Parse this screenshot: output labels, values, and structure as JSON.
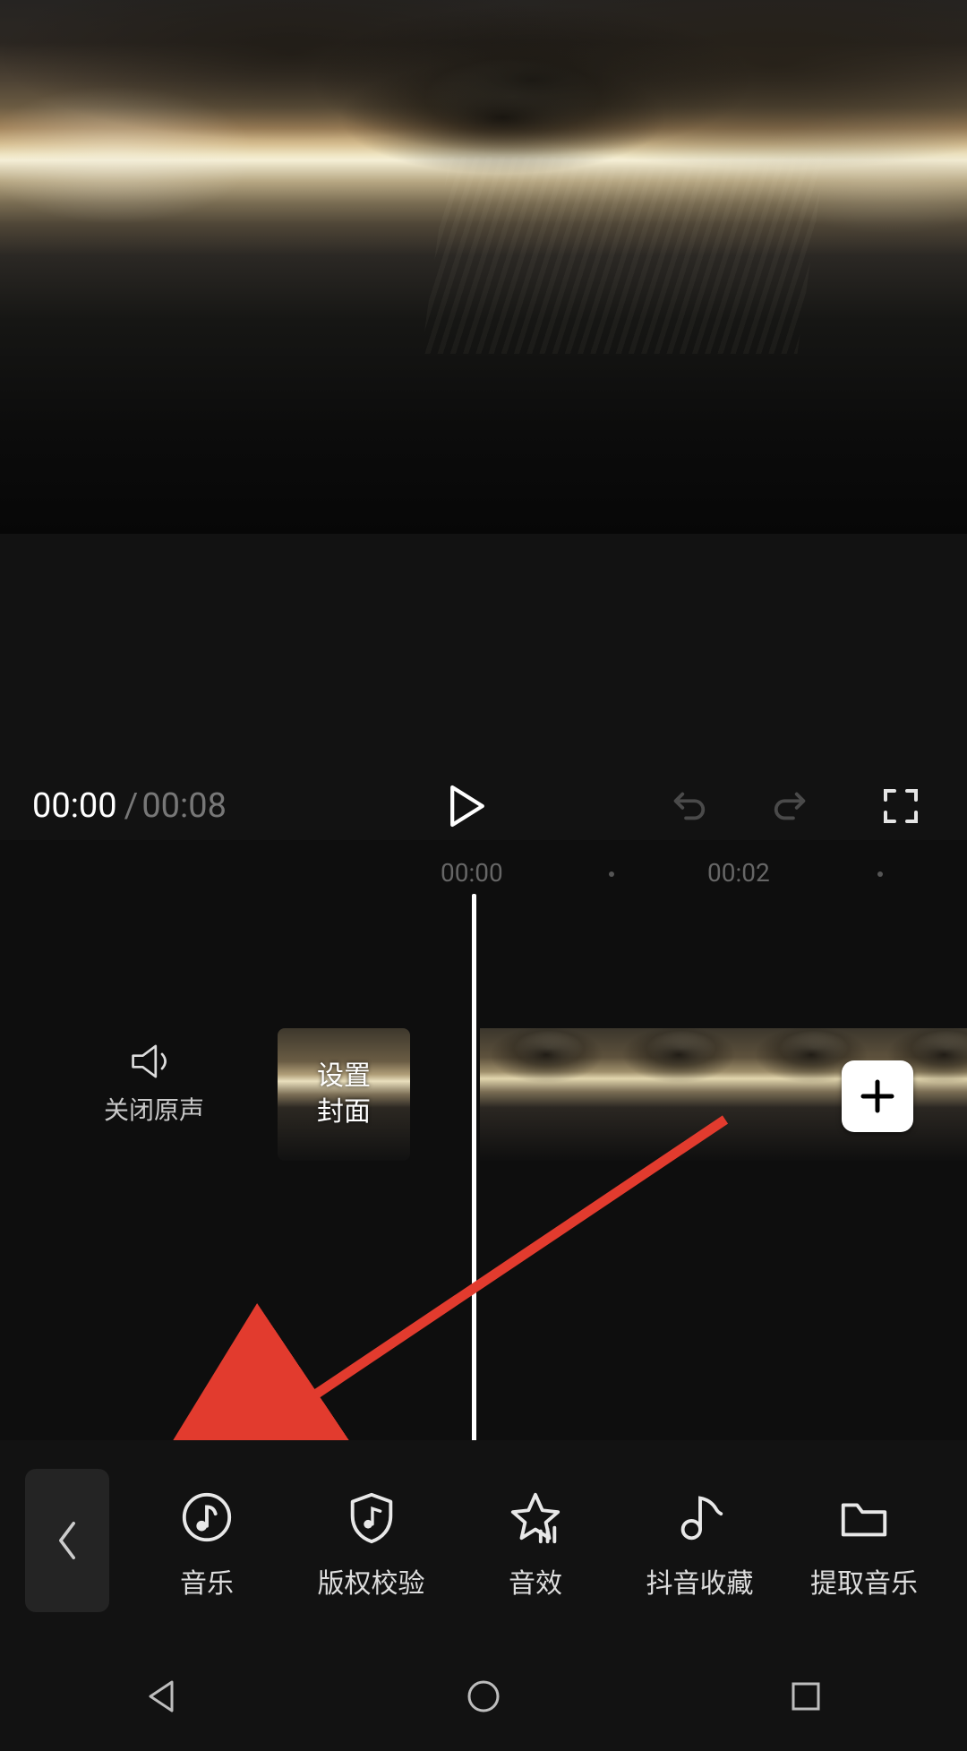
{
  "playback": {
    "current": "00:00",
    "separator": "/",
    "total": "00:08"
  },
  "ruler": {
    "t0": "00:00",
    "t2": "00:02"
  },
  "mute_label": "关闭原声",
  "cover_label_l1": "设置",
  "cover_label_l2": "封面",
  "tools": {
    "music": "音乐",
    "copyright": "版权校验",
    "sfx": "音效",
    "douyin_fav": "抖音收藏",
    "extract": "提取音乐"
  }
}
